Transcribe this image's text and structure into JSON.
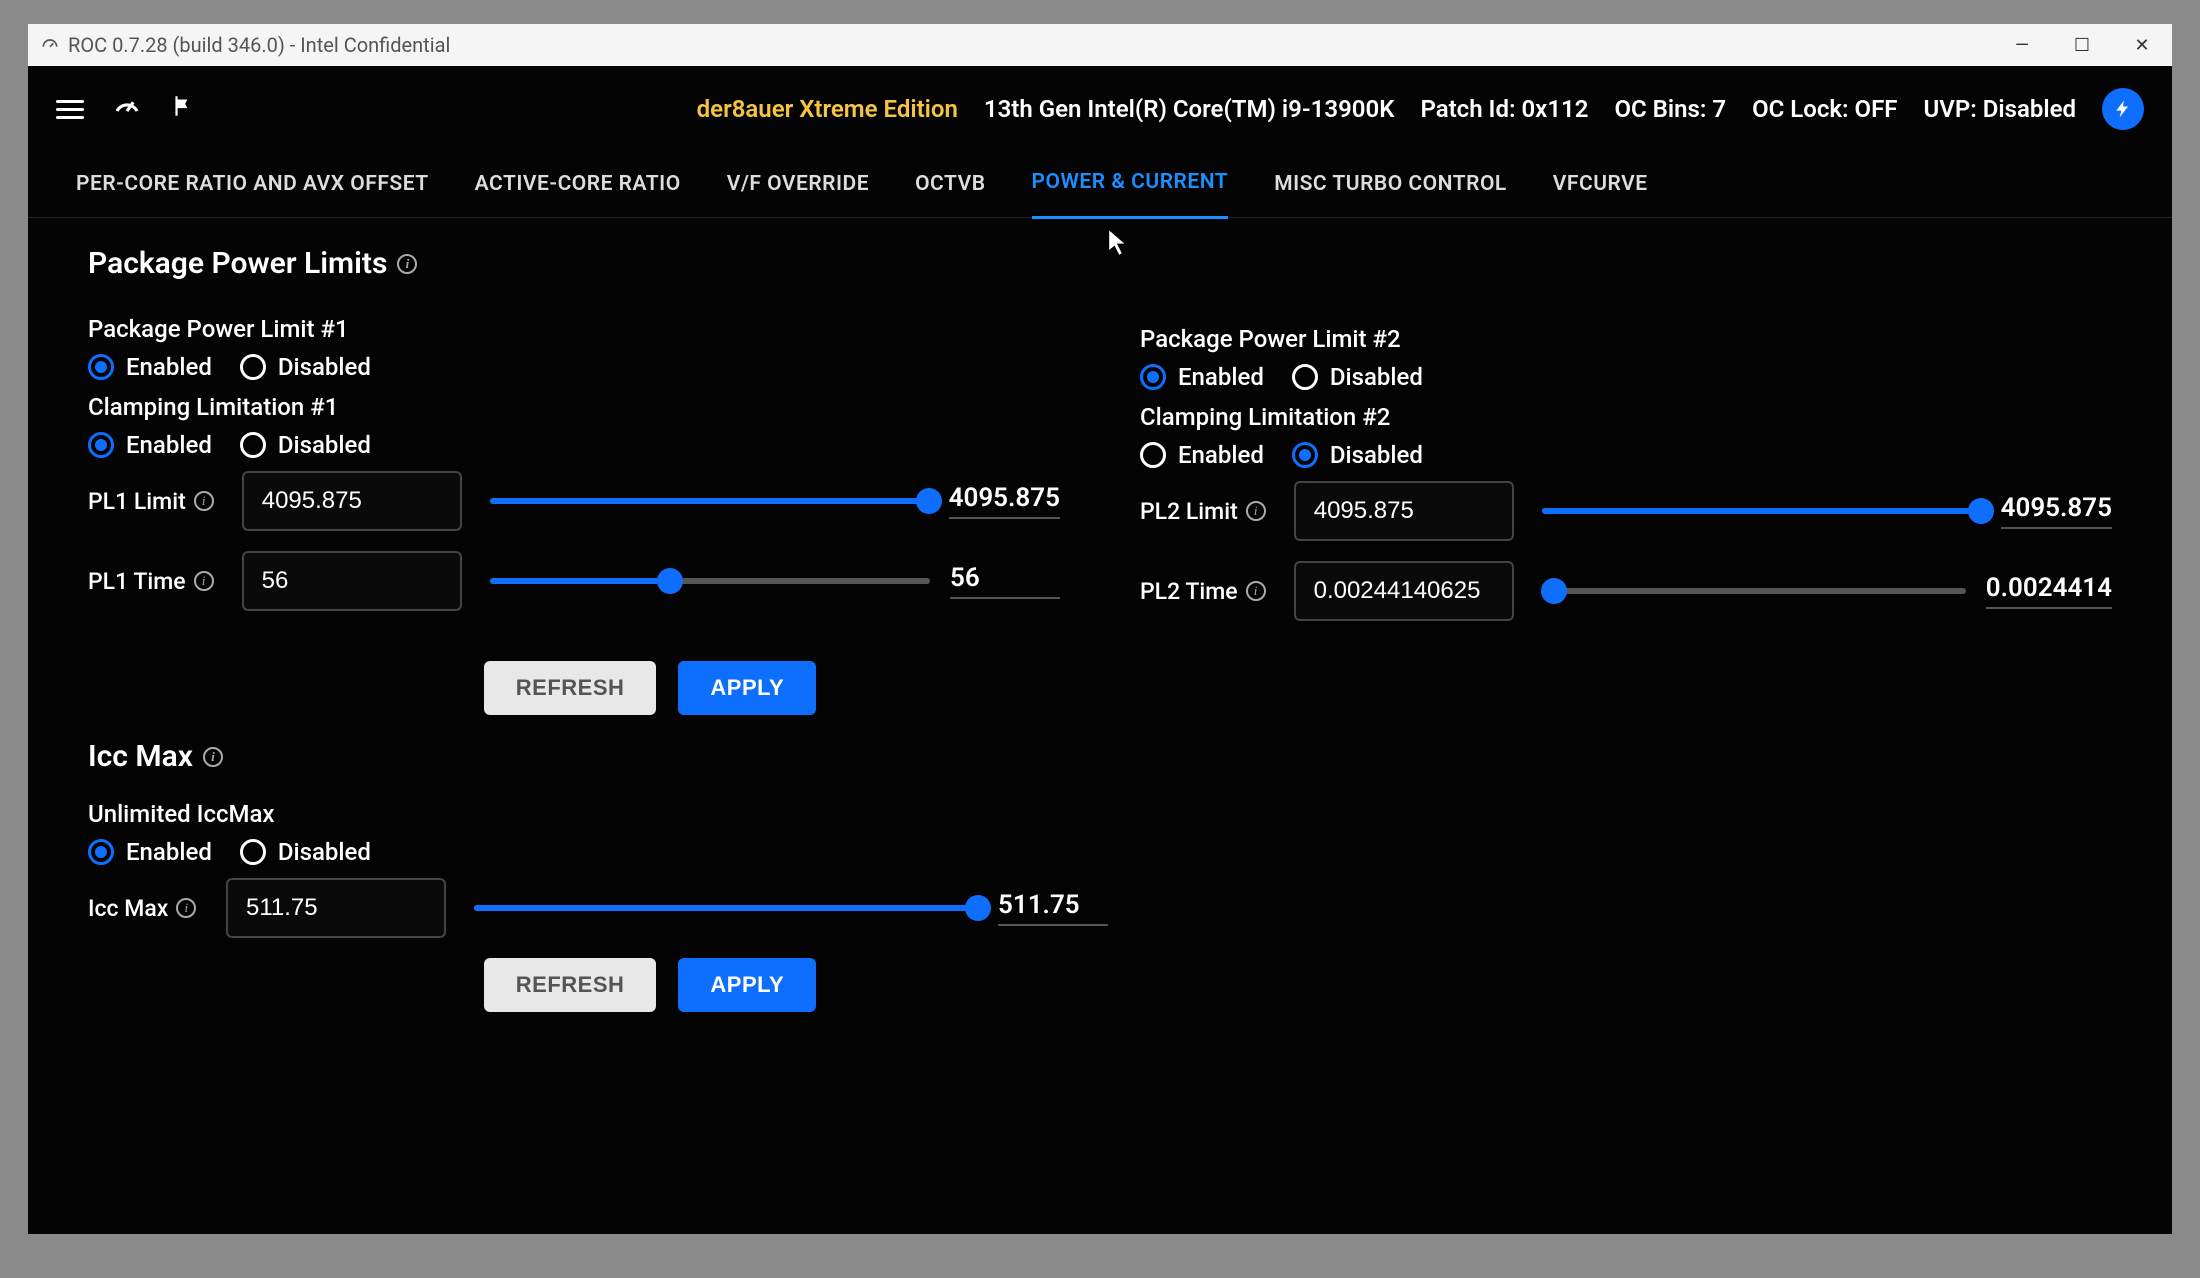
{
  "window": {
    "title": "ROC 0.7.28 (build 346.0) - Intel Confidential"
  },
  "header": {
    "edition": "der8auer Xtreme Edition",
    "cpu": "13th Gen Intel(R) Core(TM) i9-13900K",
    "patch": "Patch Id: 0x112",
    "bins": "OC Bins: 7",
    "lock": "OC Lock: OFF",
    "uvp": "UVP: Disabled"
  },
  "tabs": [
    "PER-CORE RATIO AND AVX OFFSET",
    "ACTIVE-CORE RATIO",
    "V/F OVERRIDE",
    "OCTVB",
    "POWER & CURRENT",
    "MISC TURBO CONTROL",
    "VFCURVE"
  ],
  "activeTab": 4,
  "ppl": {
    "section_title": "Package Power Limits",
    "pl1": {
      "title": "Package Power Limit #1",
      "enabled": "Enabled",
      "disabled": "Disabled",
      "enabled_selected": true,
      "clamp_title": "Clamping Limitation #1",
      "clamp_enabled_selected": true,
      "limit_label": "PL1 Limit",
      "limit_value": "4095.875",
      "limit_slider": "4095.875",
      "limit_pct": 100,
      "time_label": "PL1 Time",
      "time_value": "56",
      "time_slider": "56",
      "time_pct": 41
    },
    "pl2": {
      "title": "Package Power Limit #2",
      "enabled": "Enabled",
      "disabled": "Disabled",
      "enabled_selected": true,
      "clamp_title": "Clamping Limitation #2",
      "clamp_enabled_selected": false,
      "limit_label": "PL2 Limit",
      "limit_value": "4095.875",
      "limit_slider": "4095.875",
      "limit_pct": 100,
      "time_label": "PL2 Time",
      "time_value": "0.00244140625",
      "time_slider": "0.0024414",
      "time_pct": 3
    },
    "refresh": "REFRESH",
    "apply": "APPLY"
  },
  "icc": {
    "section_title": "Icc Max",
    "unlimited_title": "Unlimited IccMax",
    "enabled": "Enabled",
    "disabled": "Disabled",
    "enabled_selected": true,
    "label": "Icc Max",
    "value": "511.75",
    "slider": "511.75",
    "pct": 100,
    "refresh": "REFRESH",
    "apply": "APPLY"
  }
}
